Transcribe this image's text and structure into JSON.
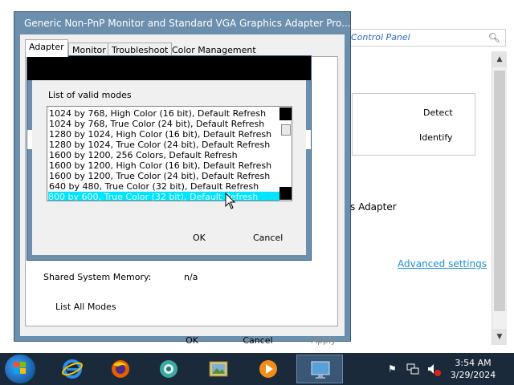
{
  "background_window": {
    "address_text": "Control Panel",
    "search_icon": "search-icon",
    "detect_label": "Detect",
    "identify_label": "Identify",
    "adapter_text": "s Adapter",
    "advanced_link": "Advanced settings",
    "link_color": "#1f8fd8"
  },
  "properties_dialog": {
    "title": "Generic Non-PnP Monitor and Standard VGA Graphics Adapter Pro...",
    "tabs": [
      {
        "label": "Adapter",
        "active": true
      },
      {
        "label": "Monitor",
        "active": false
      },
      {
        "label": "Troubleshoot",
        "active": false
      },
      {
        "label": "Color Management",
        "active": false
      }
    ],
    "shared_memory_label": "Shared System Memory:",
    "shared_memory_value": "n/a",
    "list_all_modes_label": "List All Modes",
    "ok_label": "OK",
    "cancel_label": "Cancel",
    "apply_label": "Apply"
  },
  "modes_dialog": {
    "heading": "List of valid modes",
    "modes": [
      "1024 by 768, High Color (16 bit), Default Refresh",
      "1024 by 768, True Color (24 bit), Default Refresh",
      "1280 by 1024, High Color (16 bit), Default Refresh",
      "1280 by 1024, True Color (24 bit), Default Refresh",
      "1600 by 1200, 256 Colors, Default Refresh",
      "1600 by 1200, High Color (16 bit), Default Refresh",
      "1600 by 1200, True Color (24 bit), Default Refresh",
      "640 by 480, True Color (32 bit), Default Refresh",
      "800 by 600, True Color (32 bit), Default Refresh"
    ],
    "selected_index": 8,
    "selection_color": "#00e5ff",
    "ok_label": "OK",
    "cancel_label": "Cancel"
  },
  "taskbar": {
    "items": [
      {
        "name": "internet-explorer-icon",
        "active": false
      },
      {
        "name": "firefox-icon",
        "active": false
      },
      {
        "name": "media-center-icon",
        "active": false
      },
      {
        "name": "image-viewer-icon",
        "active": false
      },
      {
        "name": "media-player-icon",
        "active": false
      },
      {
        "name": "display-settings-icon",
        "active": true
      }
    ],
    "clock_time": "3:54 AM",
    "clock_date": "3/29/2024"
  }
}
